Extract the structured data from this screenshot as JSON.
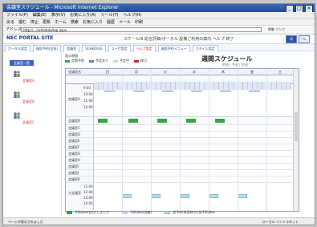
{
  "window": {
    "title": "会議室スケジュール - Microsoft Internet Explorer",
    "buttons": [
      "_",
      "□",
      "×"
    ]
  },
  "menus": [
    "ファイル(F)",
    "編集(E)",
    "表示(V)",
    "お気に入り(A)",
    "ツール(T)",
    "ヘルプ(H)"
  ],
  "toolbar": [
    "戻る",
    "進む",
    "停止",
    "更新",
    "ホーム",
    "検索",
    "お気に入り",
    "履歴",
    "メール",
    "印刷"
  ],
  "address": {
    "label": "アドレス",
    "value": "http://…/schedule/top.aspx",
    "go": "移動 リンク"
  },
  "site": {
    "logo": "NEC PORTAL SITE",
    "header_links": "スケールIII  総合評価/ポータル  設備ご利用の案内  ヘルプ  終了",
    "header_buttons": [
      "戻",
      "へ"
    ]
  },
  "tabs": [
    "ポータル設定",
    "施設予約(全体)",
    "会議室",
    "SCHEDULE",
    "ユーザ設定",
    "ヘルプ設定",
    "施設予約メニュー",
    "スタイル設定"
  ],
  "sidebar": {
    "title": "会議室一覧",
    "rooms": [
      "会議室A",
      "会議室B",
      "会議室C"
    ]
  },
  "legend_top": {
    "items": [
      {
        "label": "定期予約",
        "color": "#3aa447"
      },
      {
        "label": "予定あり",
        "color": "#5d7fb7"
      },
      {
        "label": "予定中",
        "color": "#b7dceb"
      },
      {
        "label": "終日",
        "color": "#c0262d"
      }
    ],
    "heading": "表示期間"
  },
  "schedule": {
    "title": "週間スケジュール",
    "nav": "前週 | 今週 | 次週",
    "days": [
      "日",
      "月",
      "火",
      "水",
      "木",
      "金",
      "土"
    ],
    "corner": "会議室名",
    "rows": [
      "会議室A",
      "会議室B",
      "会議室C",
      "会議室D",
      "会議室E",
      "会議室F",
      "会議室G",
      "会議室H",
      "会議室I",
      "会議室J",
      "会議室K"
    ],
    "time_labels": [
      "9:00",
      "10:00",
      "11:00",
      "12:00",
      "13:00",
      "14:00"
    ],
    "footer_room": "大会議室"
  },
  "legend_bottom": [
    {
      "label": "予約済み(自分)しました",
      "color": "#3aa447"
    },
    {
      "label": "予約済み(他者)",
      "color": "#5d7fb7"
    },
    {
      "label": "仮予約(承認待ち)/仮予約済み",
      "color": "#b7dceb"
    }
  ],
  "status": {
    "left": "ページが表示されました",
    "right": "ローカル イントラネット"
  }
}
